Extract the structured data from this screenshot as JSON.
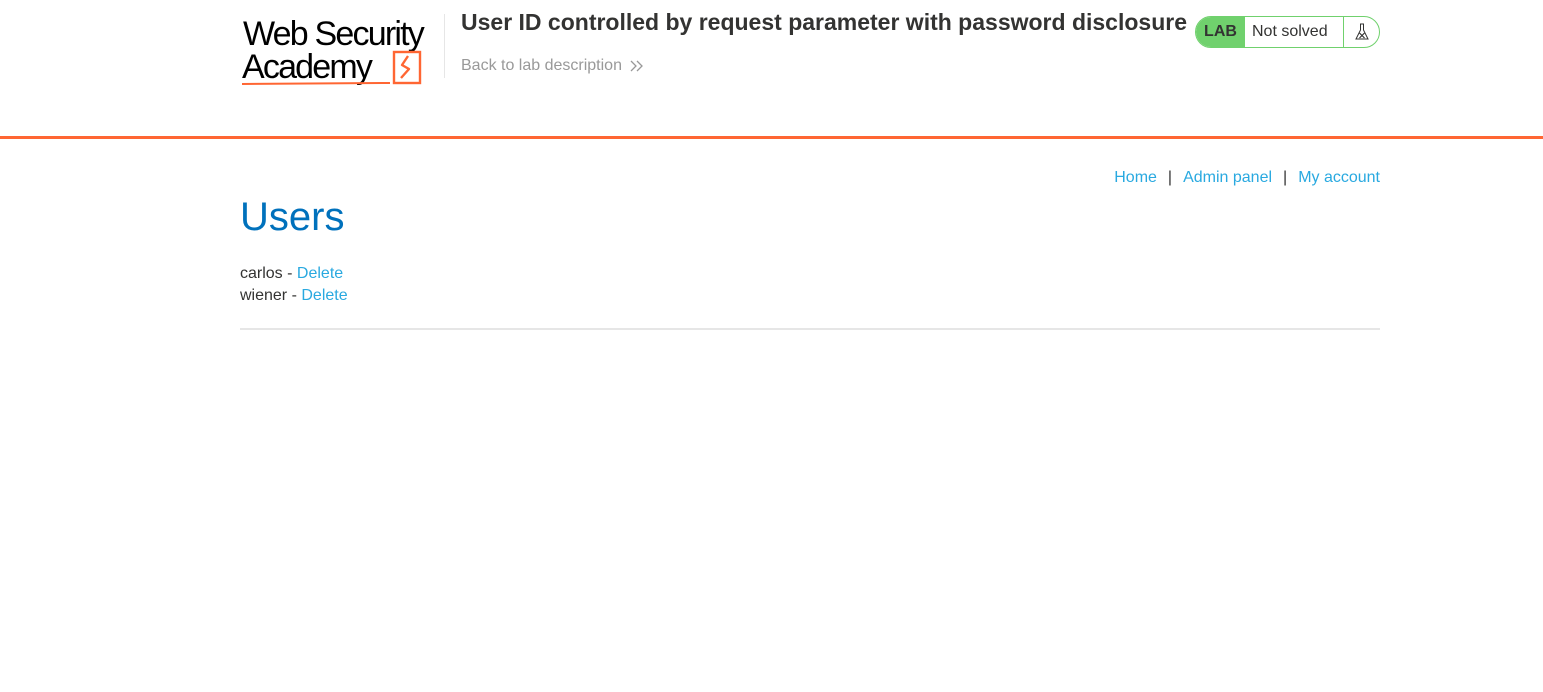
{
  "brand": {
    "line1": "Web Security",
    "line2": "Academy"
  },
  "lab": {
    "title": "User ID controlled by request parameter with password disclosure",
    "back_link": "Back to lab description",
    "badge": "LAB",
    "status": "Not solved",
    "status_icon": "flask-icon"
  },
  "nav": {
    "home": "Home",
    "separator": "|",
    "admin": "Admin panel",
    "account": "My account"
  },
  "page": {
    "heading": "Users"
  },
  "users": [
    {
      "name": "carlos",
      "dash": "-",
      "action": "Delete"
    },
    {
      "name": "wiener",
      "dash": "-",
      "action": "Delete"
    }
  ],
  "colors": {
    "accent_orange": "#ff6633",
    "link_blue": "#29a9e0",
    "heading_blue": "#0071bc",
    "lab_green": "#70d16d"
  }
}
